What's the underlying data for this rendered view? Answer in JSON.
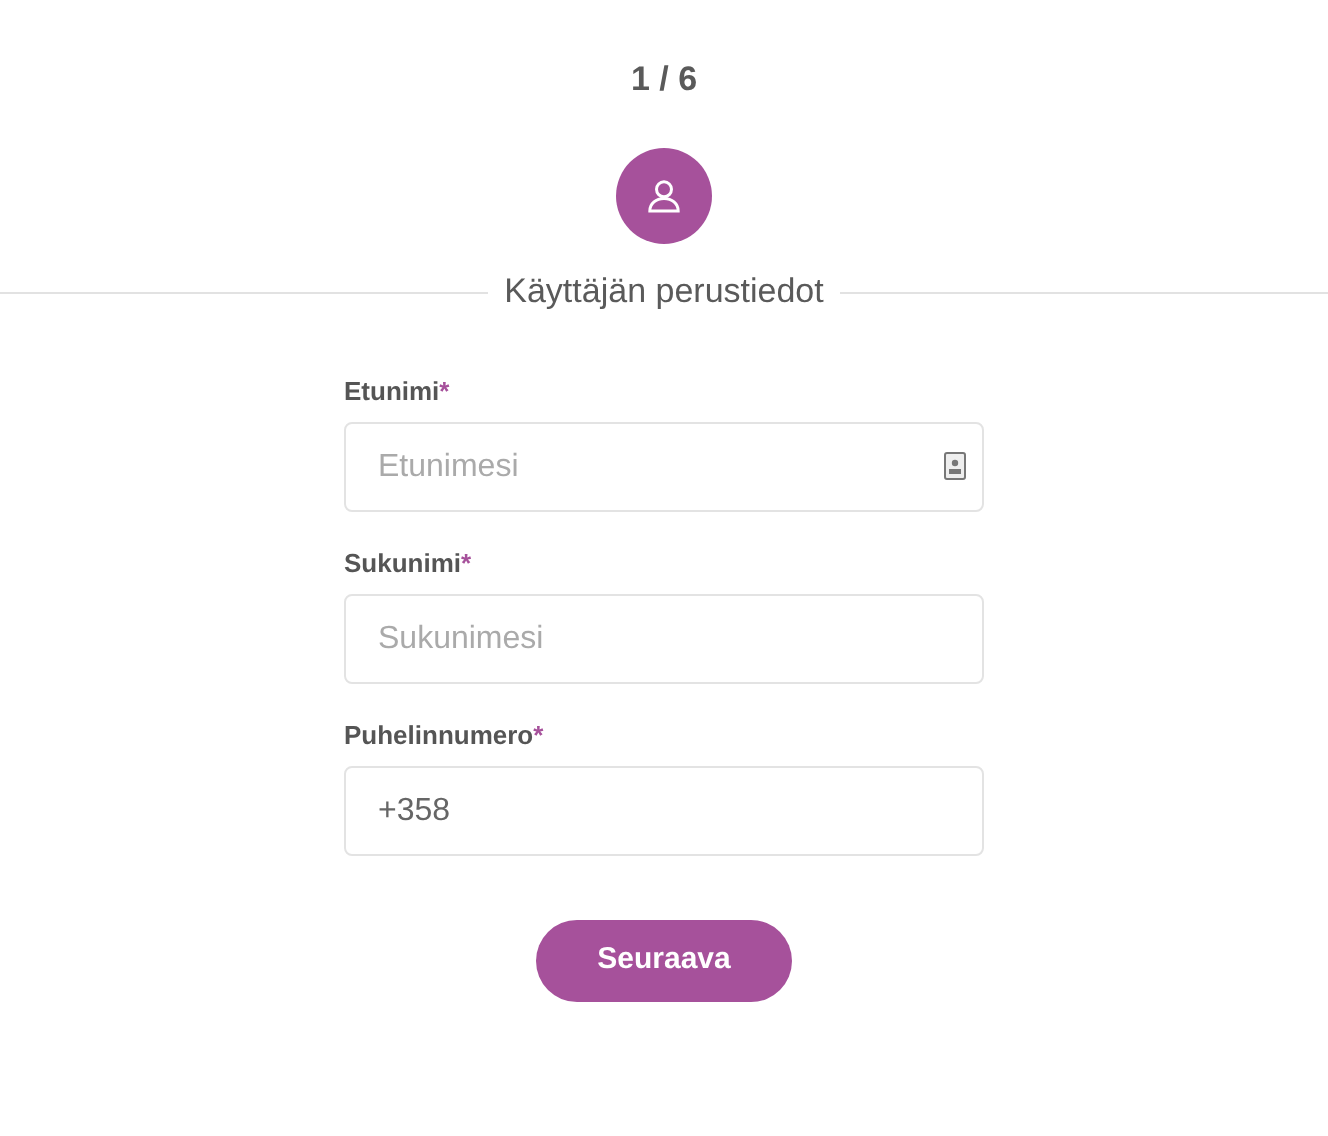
{
  "step": "1 / 6",
  "section_title": "Käyttäjän perustiedot",
  "fields": [
    {
      "label": "Etunimi",
      "required_mark": "*",
      "placeholder": "Etunimesi",
      "autofill_icon": true
    },
    {
      "label": "Sukunimi",
      "required_mark": "*",
      "placeholder": "Sukunimesi",
      "autofill_icon": false
    },
    {
      "label": "Puhelinnumero",
      "required_mark": "*",
      "value": "+358",
      "autofill_icon": false
    }
  ],
  "submit_button": "Seuraava"
}
